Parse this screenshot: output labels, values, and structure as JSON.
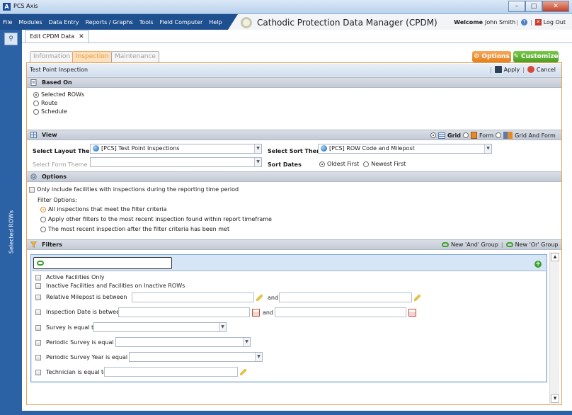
{
  "window": {
    "title": "PCS Axis",
    "icon_text": "A",
    "controls": [
      "–",
      "□",
      "✕"
    ]
  },
  "menu": [
    "File",
    "Modules",
    "Data Entry",
    "Reports / Graphs",
    "Tools",
    "Field Computer",
    "Help"
  ],
  "app_title": "Cathodic Protection Data Manager (CPDM)",
  "user": {
    "welcome": "Welcome",
    "name": "John Smith",
    "logout": "Log Out"
  },
  "sidebar": {
    "search_icon": "⚲",
    "vertical_label": "Selected ROWs"
  },
  "doc_tab": {
    "label": "Edit CPDM Data",
    "close": "✕"
  },
  "subtabs": [
    "Information",
    "Inspection",
    "Maintenance"
  ],
  "top_buttons": {
    "options": "Options",
    "customize": "Customize"
  },
  "panel": {
    "title": "Test Point Inspection",
    "apply": "Apply",
    "cancel": "Cancel"
  },
  "based_on": {
    "heading": "Based On",
    "options": [
      "Selected ROWs",
      "Route",
      "Schedule"
    ],
    "selected": 0
  },
  "view": {
    "heading": "View",
    "modes": [
      "Grid",
      "Form",
      "Grid And Form"
    ],
    "selected_mode": 0,
    "layout_label": "Select Layout Theme",
    "layout_value": "[PCS] Test Point Inspections",
    "form_label": "Select Form Theme",
    "form_value": "",
    "sort_label": "Select Sort Theme",
    "sort_value": "[PCS] ROW Code and Milepost",
    "sort_dates_label": "Sort Dates",
    "sort_dates_options": [
      "Oldest First",
      "Newest First"
    ],
    "sort_dates_selected": 0
  },
  "options": {
    "heading": "Options",
    "only_include": "Only include facilities with inspections during the reporting time period",
    "filter_options_label": "Filter Options:",
    "filter_options": [
      "All inspections that meet the filter criteria",
      "Apply other filters to the most recent inspection found within report timeframe",
      "The most recent inspection after the filter criteria has been met"
    ],
    "filter_selected": 0
  },
  "filters": {
    "heading": "Filters",
    "new_and": "New 'And' Group",
    "new_or": "New 'Or' Group",
    "add_icon": "+",
    "items": [
      "Active Facilities Only",
      "Inactive Facilities and Facilities on Inactive ROWs",
      "Relative Milepost is between",
      "Inspection Date is between",
      "Survey is equal to",
      "Periodic Survey is equal to",
      "Periodic Survey Year is equal to",
      "Technician is equal to"
    ],
    "and_label": "and"
  }
}
